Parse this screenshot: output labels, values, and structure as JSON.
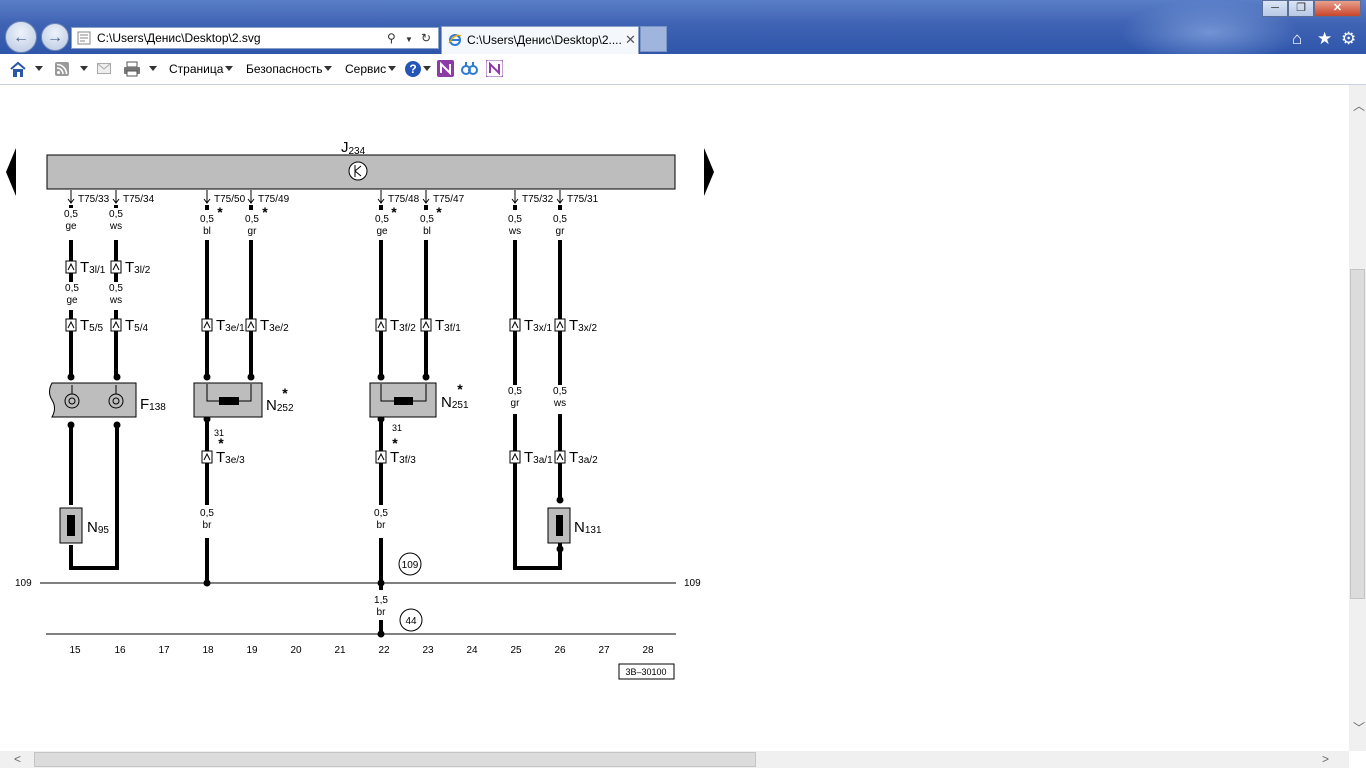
{
  "browser": {
    "address_url": "C:\\Users\\Денис\\Desktop\\2.svg",
    "tab_title": "C:\\Users\\Денис\\Desktop\\2....",
    "tab_close": "✕",
    "minimize": "─",
    "maximize": "❐",
    "close": "✕"
  },
  "toolbar": {
    "page_menu": "Страница",
    "safety_menu": "Безопасность",
    "tools_menu": "Сервис",
    "help": "?"
  },
  "diagram": {
    "control_unit": {
      "main": "J",
      "sub": "234"
    },
    "ground_label": "109",
    "page_ref": "3B–30100",
    "circle_refs": [
      "109",
      "44"
    ],
    "pins": [
      "T75/33",
      "T75/34",
      "T75/50",
      "T75/49",
      "T75/48",
      "T75/47",
      "T75/32",
      "T75/31"
    ],
    "wires": [
      [
        "0,5",
        "ge"
      ],
      [
        "0,5",
        "ws"
      ],
      [
        "0,5",
        "bl"
      ],
      [
        "0,5",
        "gr"
      ],
      [
        "0,5",
        "ge"
      ],
      [
        "0,5",
        "bl"
      ],
      [
        "0,5",
        "ws"
      ],
      [
        "0,5",
        "gr"
      ],
      [
        "0,5",
        "ge"
      ],
      [
        "0,5",
        "ws"
      ],
      [
        "0,5",
        "gr"
      ],
      [
        "0,5",
        "ws"
      ],
      [
        "0,5",
        "br"
      ],
      [
        "0,5",
        "br"
      ],
      [
        "1,5",
        "br"
      ]
    ],
    "connectors": [
      [
        "T",
        "3l/1"
      ],
      [
        "T",
        "3l/2"
      ],
      [
        "T",
        "5/5"
      ],
      [
        "T",
        "5/4"
      ],
      [
        "T",
        "3e/1"
      ],
      [
        "T",
        "3e/2"
      ],
      [
        "T",
        "3f/2"
      ],
      [
        "T",
        "3f/1"
      ],
      [
        "T",
        "3x/1"
      ],
      [
        "T",
        "3x/2"
      ],
      [
        "T",
        "3e/3"
      ],
      [
        "T",
        "3f/3"
      ],
      [
        "T",
        "3a/1"
      ],
      [
        "T",
        "3a/2"
      ]
    ],
    "components": [
      [
        "F",
        "138"
      ],
      [
        "N",
        "252"
      ],
      [
        "N",
        "251"
      ],
      [
        "N",
        "95"
      ],
      [
        "N",
        "131"
      ]
    ],
    "ground_num": "31",
    "star": "*",
    "columns": [
      "15",
      "16",
      "17",
      "18",
      "19",
      "20",
      "21",
      "22",
      "23",
      "24",
      "25",
      "26",
      "27",
      "28"
    ]
  }
}
